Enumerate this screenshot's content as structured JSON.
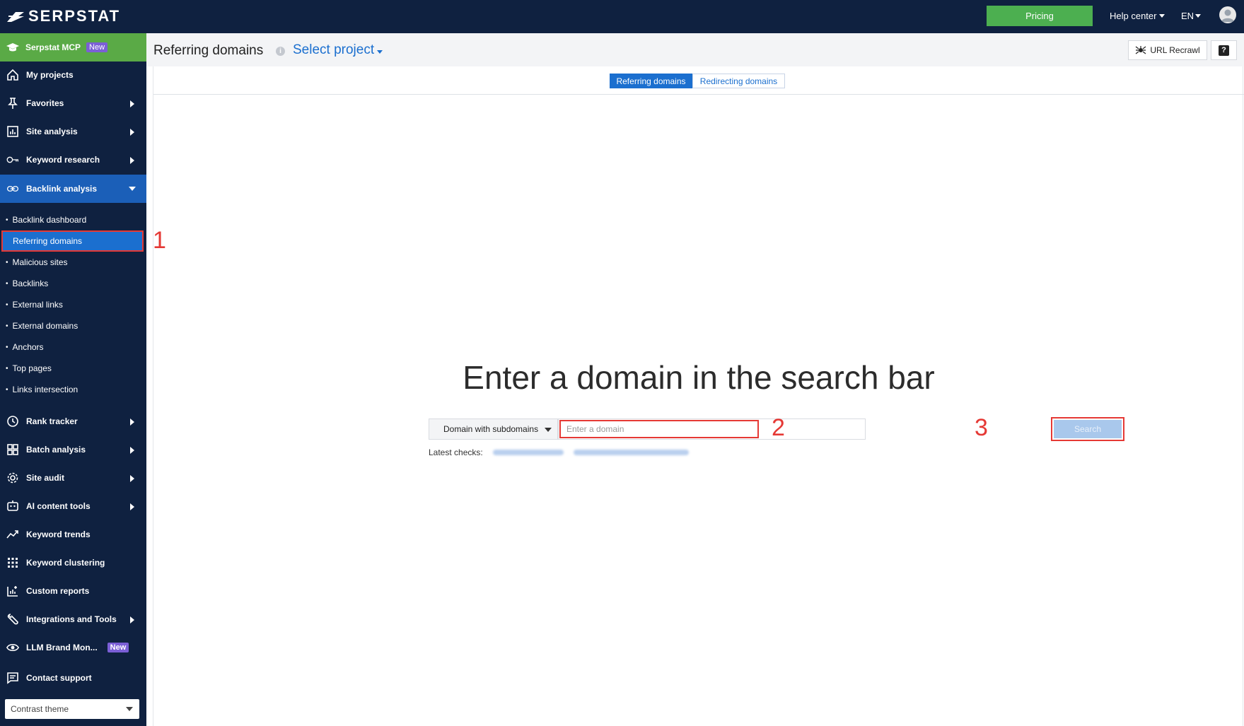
{
  "topbar": {
    "logo_text": "SERPSTAT",
    "pricing_label": "Pricing",
    "help_center_label": "Help center",
    "language_label": "EN"
  },
  "sidebar": {
    "mcp": {
      "label": "Serpstat MCP",
      "badge": "New"
    },
    "items": [
      {
        "label": "My projects",
        "icon": "home-icon"
      },
      {
        "label": "Favorites",
        "icon": "pin-icon"
      },
      {
        "label": "Site analysis",
        "icon": "chart-icon"
      },
      {
        "label": "Keyword research",
        "icon": "key-icon"
      },
      {
        "label": "Backlink analysis",
        "icon": "link-icon"
      }
    ],
    "backlink_subitems": [
      "Backlink dashboard",
      "Referring domains",
      "Malicious sites",
      "Backlinks",
      "External links",
      "External domains",
      "Anchors",
      "Top pages",
      "Links intersection"
    ],
    "lower_items": [
      {
        "label": "Rank tracker",
        "icon": "clock-icon"
      },
      {
        "label": "Batch analysis",
        "icon": "grid-icon"
      },
      {
        "label": "Site audit",
        "icon": "gear-icon"
      },
      {
        "label": "AI content tools",
        "icon": "robot-icon"
      },
      {
        "label": "Keyword trends",
        "icon": "trend-icon"
      },
      {
        "label": "Keyword clustering",
        "icon": "dots-grid-icon"
      },
      {
        "label": "Custom reports",
        "icon": "report-icon"
      },
      {
        "label": "Integrations and Tools",
        "icon": "wrench-icon"
      },
      {
        "label": "LLM Brand Mon...",
        "icon": "eye-icon",
        "badge": "New"
      },
      {
        "label": "Contact support",
        "icon": "chat-icon"
      }
    ],
    "theme_select": "Contrast theme"
  },
  "annotations": {
    "one": "1",
    "two": "2",
    "three": "3"
  },
  "header": {
    "title": "Referring domains",
    "info_icon": "i",
    "project_select": "Select project",
    "recrawl_label": "URL Recrawl",
    "help_label": "?"
  },
  "tabs": [
    "Referring domains",
    "Redirecting domains"
  ],
  "main": {
    "headline": "Enter a domain in the search bar",
    "scope_select": "Domain with subdomains",
    "search_placeholder": "Enter a domain",
    "search_button": "Search",
    "latest_label": "Latest checks:"
  },
  "colors": {
    "topbar_bg": "#0f2140",
    "accent_blue": "#1b6fcf",
    "pricing_green": "#4caf50",
    "mcp_green": "#5aaa46",
    "annotation_red": "#e53935"
  }
}
